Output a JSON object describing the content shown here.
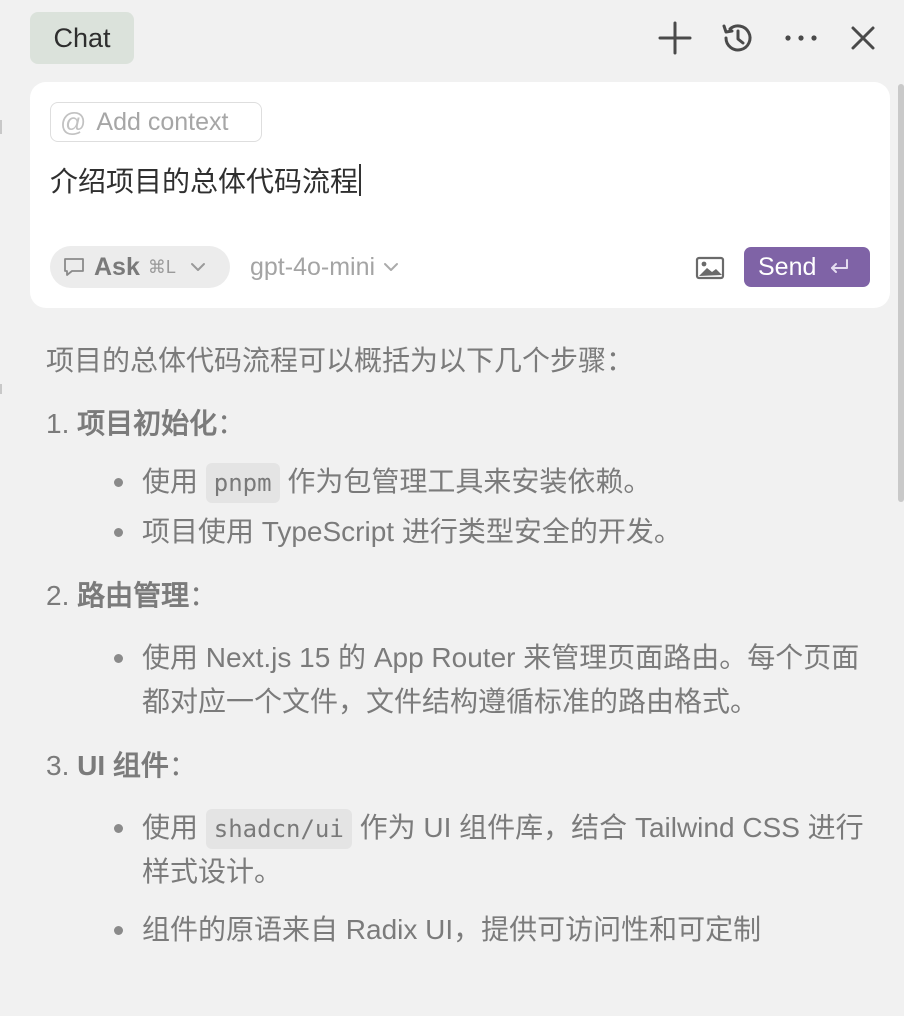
{
  "header": {
    "tab_label": "Chat",
    "actions": {
      "new_chat": "plus-icon",
      "history": "history-icon",
      "more": "more-icon",
      "close": "close-icon"
    }
  },
  "composer": {
    "add_context_label": "Add context",
    "prompt_text": "介绍项目的总体代码流程",
    "mode": {
      "label": "Ask",
      "shortcut": "⌘L"
    },
    "model": "gpt-4o-mini",
    "send_label": "Send"
  },
  "response": {
    "intro": "项目的总体代码流程可以概括为以下几个步骤：",
    "steps": [
      {
        "number": "1.",
        "title": "项目初始化",
        "suffix": "：",
        "bullets": [
          {
            "before": "使用 ",
            "code": "pnpm",
            "after": " 作为包管理工具来安装依赖。"
          },
          {
            "text": "项目使用 TypeScript 进行类型安全的开发。"
          }
        ]
      },
      {
        "number": "2.",
        "title": "路由管理",
        "suffix": "：",
        "bullets": [
          {
            "text": "使用 Next.js 15 的 App Router 来管理页面路由。每个页面都对应一个文件，文件结构遵循标准的路由格式。"
          }
        ]
      },
      {
        "number": "3.",
        "title": "UI 组件",
        "suffix": "：",
        "bullets": [
          {
            "before": "使用 ",
            "code": "shadcn/ui",
            "after": " 作为 UI 组件库，结合 Tailwind CSS 进行样式设计。"
          },
          {
            "text": "组件的原语来自 Radix UI，提供可访问性和可定制"
          }
        ]
      }
    ]
  },
  "colors": {
    "background": "#f1f1f1",
    "chat_tab": "#dbe2db",
    "send_button": "#7f63a6",
    "composer": "#ffffff"
  }
}
